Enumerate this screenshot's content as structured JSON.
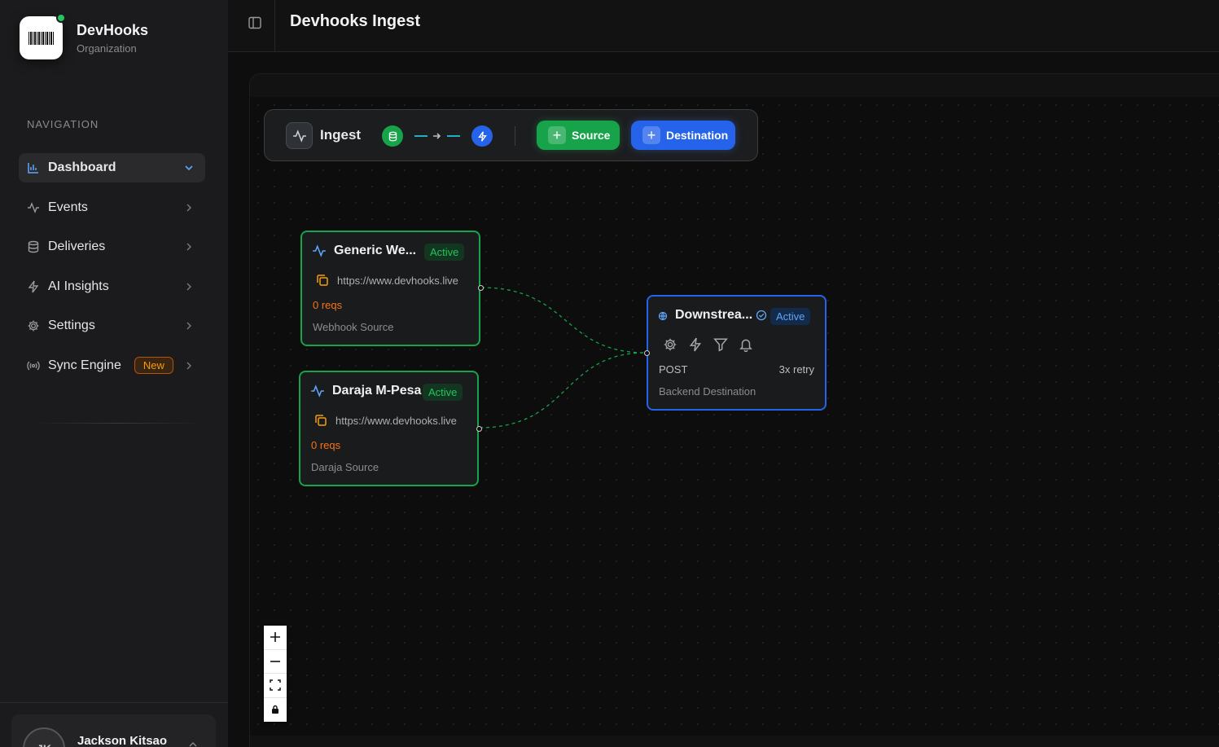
{
  "brand": {
    "name": "DevHooks",
    "subtitle": "Organization",
    "logo_icon": "barcode-icon"
  },
  "sidebar": {
    "nav_title": "NAVIGATION",
    "items": [
      {
        "label": "Dashboard",
        "icon": "bar-chart-icon",
        "active": true
      },
      {
        "label": "Events",
        "icon": "activity-icon"
      },
      {
        "label": "Deliveries",
        "icon": "database-icon"
      },
      {
        "label": "AI Insights",
        "icon": "zap-icon"
      },
      {
        "label": "Settings",
        "icon": "gear-icon"
      },
      {
        "label": "Sync Engine",
        "icon": "radio-icon",
        "badge": "New"
      }
    ],
    "user": {
      "initials": "JK",
      "name": "Jackson Kitsao"
    }
  },
  "header": {
    "title": "Devhooks Ingest"
  },
  "pipeline": {
    "title": "Ingest",
    "source_button": "Source",
    "destination_button": "Destination"
  },
  "sources": [
    {
      "title": "Generic We...",
      "status": "Active",
      "url": "https://www.devhooks.live",
      "reqs": "0 reqs",
      "type": "Webhook Source"
    },
    {
      "title": "Daraja M-Pesa",
      "status": "Active",
      "url": "https://www.devhooks.live",
      "reqs": "0 reqs",
      "type": "Daraja Source"
    }
  ],
  "destination": {
    "title": "Downstrea...",
    "status": "Active",
    "method": "POST",
    "retry": "3x retry",
    "type": "Backend Destination"
  },
  "colors": {
    "source": "#16a34a",
    "destination": "#2563eb",
    "accent": "#60a5fa",
    "warning": "#f97316"
  }
}
